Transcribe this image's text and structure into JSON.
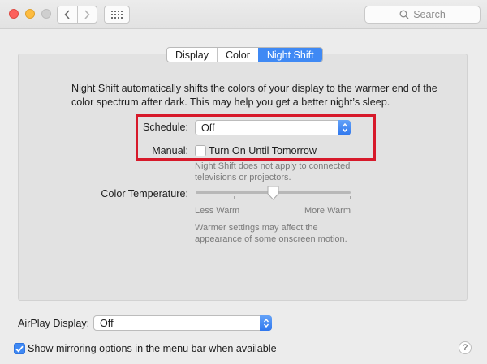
{
  "toolbar": {
    "back_icon": "chevron-left-icon",
    "forward_icon": "chevron-right-icon",
    "show_all_icon": "grid-icon",
    "search_placeholder": "Search"
  },
  "tabs": [
    {
      "label": "Display",
      "active": false
    },
    {
      "label": "Color",
      "active": false
    },
    {
      "label": "Night Shift",
      "active": true
    }
  ],
  "night_shift": {
    "description": "Night Shift automatically shifts the colors of your display to the warmer end of the color spectrum after dark. This may help you get a better night’s sleep.",
    "schedule_label": "Schedule:",
    "schedule_value": "Off",
    "manual_label": "Manual:",
    "manual_checkbox_label": "Turn On Until Tomorrow",
    "manual_checked": false,
    "manual_note": "Night Shift does not apply to connected televisions or projectors.",
    "color_temperature_label": "Color Temperature:",
    "slider_min_label": "Less Warm",
    "slider_max_label": "More Warm",
    "slider_value": 0.5,
    "slider_note": "Warmer settings may affect the appearance of some onscreen motion."
  },
  "footer": {
    "airplay_label": "AirPlay Display:",
    "airplay_value": "Off",
    "mirroring_label": "Show mirroring options in the menu bar when available",
    "mirroring_checked": true,
    "help_label": "?"
  },
  "colors": {
    "accent": "#3f89f4",
    "highlight": "#d7192a"
  }
}
